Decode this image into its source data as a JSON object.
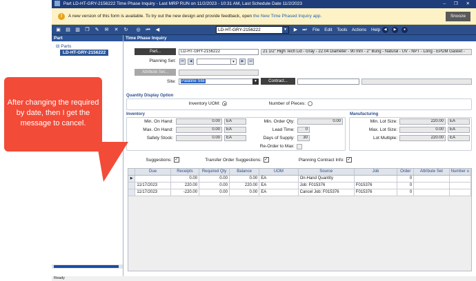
{
  "window": {
    "title": "Part LD-HT-GRY-2156222 Time Phase Inquiry  - Last MRP RUN on 11/2/2023 - 10:31 AM, Last Schedule Date  11/2/2023",
    "controls": "– ❐ ✕"
  },
  "notice": {
    "text": "A new version of this form is available. To try out the new design and provide feedback, open ",
    "link": "the New Time Phased Inquiry app.",
    "snooze": "Snooze"
  },
  "toolbar": {
    "part_combo": "LD-HT-GRY-2156222"
  },
  "menu": [
    "File",
    "Edit",
    "Tools",
    "Actions",
    "Help"
  ],
  "part_panel": {
    "header": "Part",
    "tree_root": "Parts",
    "tree_item": "LD-HT-GRY-2156222"
  },
  "main": {
    "header": "Time Phase Inquiry",
    "part_button": "Part...",
    "part_value": "LD-HT-GRY-2156222",
    "description": "21 1/2\" High Tech Lid - Gray - 22.04 Diameter - 90 mm - 2\" Bung - Natural - UV - NPT - Long - EPDM Gasket -",
    "planning_set_label": "Planning Set:",
    "attribute_set_button": "Attribute Set...",
    "site_label": "Site:",
    "site_value": "Palatine Site",
    "contract_button": "Contract..."
  },
  "quantity_display": {
    "label": "Quantity Display Option",
    "inventory_uom_label": "Inventory UOM:",
    "pieces_label": "Number of Pieces:"
  },
  "inventory": {
    "label": "Inventory",
    "min_on_hand_label": "Min. On Hand:",
    "min_on_hand": "0.00",
    "min_on_hand_uom": "EA",
    "max_on_hand_label": "Max. On Hand:",
    "max_on_hand": "0.00",
    "max_on_hand_uom": "EA",
    "safety_stock_label": "Safety Stock:",
    "safety_stock": "0.00",
    "safety_stock_uom": "EA",
    "min_order_qty_label": "Min. Order Qty:",
    "min_order_qty": "0.00",
    "lead_time_label": "Lead Time:",
    "lead_time": "0",
    "days_supply_label": "Days of Supply:",
    "days_supply": "30",
    "reorder_max_label": "Re-Order to Max:"
  },
  "manufacturing": {
    "label": "Manufacturing",
    "min_lot_label": "Min. Lot Size:",
    "min_lot": "220.00",
    "min_lot_uom": "EA",
    "max_lot_label": "Max. Lot Size:",
    "max_lot": "0.00",
    "max_lot_uom": "EA",
    "lot_multiple_label": "Lot Multiple:",
    "lot_multiple": "220.00",
    "lot_multiple_uom": "EA"
  },
  "options": {
    "suggestions_label": "Suggestions:",
    "transfer_label": "Transfer Order Suggestions:",
    "planning_contract_label": "Planning Contract Info:",
    "check": "✓"
  },
  "grid": {
    "columns": [
      "Due",
      "Receipts",
      "Required Qty",
      "Balance",
      "UOM",
      "Source",
      "Job",
      "Order",
      "Attribute Set",
      "Number o"
    ],
    "rows": [
      {
        "indicator": "▶",
        "due": "",
        "receipts": "0.00",
        "required": "0.00",
        "balance": "0.00",
        "uom": "EA",
        "source": "On-Hand Quantity",
        "job": "",
        "order": "0",
        "attr": ""
      },
      {
        "indicator": "",
        "due": "11/17/2023",
        "receipts": "220.00",
        "required": "0.00",
        "balance": "220.00",
        "uom": "EA",
        "source": "Job: F015376",
        "job": "F015376",
        "order": "0",
        "attr": ""
      },
      {
        "indicator": "",
        "due": "11/17/2023",
        "receipts": "-220.00",
        "required": "0.00",
        "balance": "0.00",
        "uom": "EA",
        "source": "Cancel Job: F015376",
        "job": "F015376",
        "order": "0",
        "attr": ""
      }
    ]
  },
  "status": "Ready",
  "callout": {
    "text": "After changing the required by date, then I get the message to cancel."
  },
  "colors": {
    "title_bar": "#1f3d7a",
    "toolbar": "#2c4f8c",
    "callout": "#f24b38",
    "notice": "#fdf2c6"
  }
}
